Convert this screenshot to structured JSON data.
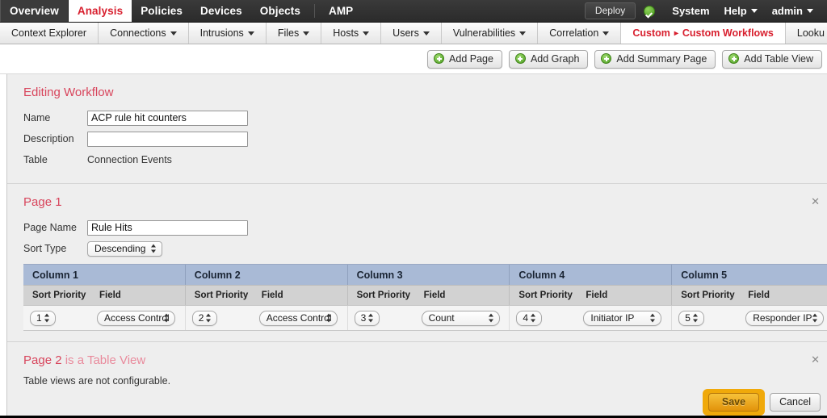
{
  "topnav": {
    "items": [
      {
        "label": "Overview",
        "active": false
      },
      {
        "label": "Analysis",
        "active": true
      },
      {
        "label": "Policies",
        "active": false
      },
      {
        "label": "Devices",
        "active": false
      },
      {
        "label": "Objects",
        "active": false
      },
      {
        "label": "AMP",
        "active": false
      }
    ],
    "deploy_label": "Deploy",
    "status_icon": "green-check-circle-icon",
    "system_label": "System",
    "help_label": "Help",
    "admin_label": "admin"
  },
  "subnav": {
    "items": [
      {
        "label": "Context Explorer",
        "caret": false,
        "active": false
      },
      {
        "label": "Connections",
        "caret": true,
        "active": false
      },
      {
        "label": "Intrusions",
        "caret": true,
        "active": false
      },
      {
        "label": "Files",
        "caret": true,
        "active": false
      },
      {
        "label": "Hosts",
        "caret": true,
        "active": false
      },
      {
        "label": "Users",
        "caret": true,
        "active": false
      },
      {
        "label": "Vulnerabilities",
        "caret": true,
        "active": false
      },
      {
        "label": "Correlation",
        "caret": true,
        "active": false
      },
      {
        "label": "Custom",
        "label2": "Custom Workflows",
        "arrow": "▸",
        "caret": false,
        "active": true
      },
      {
        "label": "Looku",
        "caret": false,
        "active": false
      }
    ]
  },
  "toolbar": {
    "buttons": [
      {
        "label": "Add Page",
        "icon": "plus-circle-icon"
      },
      {
        "label": "Add Graph",
        "icon": "plus-circle-icon"
      },
      {
        "label": "Add Summary Page",
        "icon": "plus-circle-icon"
      },
      {
        "label": "Add Table View",
        "icon": "plus-circle-icon"
      }
    ]
  },
  "workflow": {
    "title": "Editing Workflow",
    "name_label": "Name",
    "name_value": "ACP rule hit counters",
    "description_label": "Description",
    "description_value": "",
    "table_label": "Table",
    "table_value": "Connection Events"
  },
  "page1": {
    "title": "Page 1",
    "close_icon": "close-x-icon",
    "page_name_label": "Page Name",
    "page_name_value": "Rule Hits",
    "sort_type_label": "Sort Type",
    "sort_type_value": "Descending",
    "sub_headers": {
      "sort_priority": "Sort Priority",
      "field": "Field"
    },
    "columns": [
      {
        "header": "Column 1",
        "sort_priority": "1",
        "field": "Access Control"
      },
      {
        "header": "Column 2",
        "sort_priority": "2",
        "field": "Access Control"
      },
      {
        "header": "Column 3",
        "sort_priority": "3",
        "field": "Count"
      },
      {
        "header": "Column 4",
        "sort_priority": "4",
        "field": "Initiator IP"
      },
      {
        "header": "Column 5",
        "sort_priority": "5",
        "field": "Responder IP"
      }
    ]
  },
  "page2": {
    "title": "Page 2",
    "subtitle": "is a Table View",
    "close_icon": "close-x-icon",
    "note": "Table views are not configurable."
  },
  "footer": {
    "save_label": "Save",
    "cancel_label": "Cancel"
  },
  "colors": {
    "accent_red": "#d8202f",
    "section_heading": "#d8455c",
    "column_header_bg": "#a9bad6",
    "save_gold": "#e2920a",
    "status_green": "#4b9c22"
  }
}
